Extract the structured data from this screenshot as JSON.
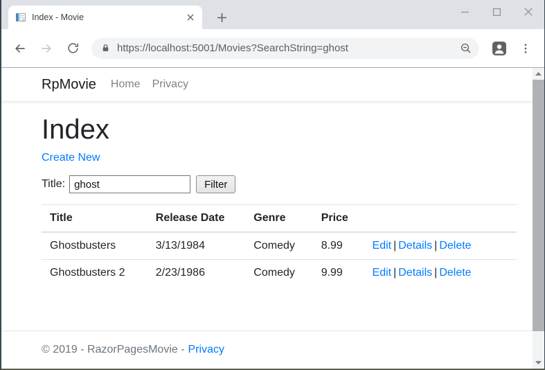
{
  "colors": {
    "accent_link": "#007bff",
    "body_text": "#212529",
    "muted_text": "#6c757d",
    "table_border": "#dee2e6",
    "tab_strip_bg": "#dee1e6",
    "omnibox_bg": "#f1f3f4",
    "chrome_icon_gray": "#5f6368"
  },
  "browser": {
    "tab_title": "Index - Movie",
    "url": "https://localhost:5001/Movies?SearchString=ghost"
  },
  "navbar": {
    "brand": "RpMovie",
    "links": [
      "Home",
      "Privacy"
    ]
  },
  "page": {
    "heading": "Index",
    "create_link": "Create New",
    "filter": {
      "label": "Title:",
      "value": "ghost",
      "button": "Filter"
    },
    "table": {
      "headers": [
        "Title",
        "Release Date",
        "Genre",
        "Price"
      ],
      "action_separator": "|",
      "rows": [
        {
          "title": "Ghostbusters",
          "release_date": "3/13/1984",
          "genre": "Comedy",
          "price": "8.99",
          "actions": [
            "Edit",
            "Details",
            "Delete"
          ]
        },
        {
          "title": "Ghostbusters 2",
          "release_date": "2/23/1986",
          "genre": "Comedy",
          "price": "9.99",
          "actions": [
            "Edit",
            "Details",
            "Delete"
          ]
        }
      ]
    }
  },
  "footer": {
    "copyright": "© 2019 - RazorPagesMovie -",
    "privacy_link": "Privacy"
  }
}
